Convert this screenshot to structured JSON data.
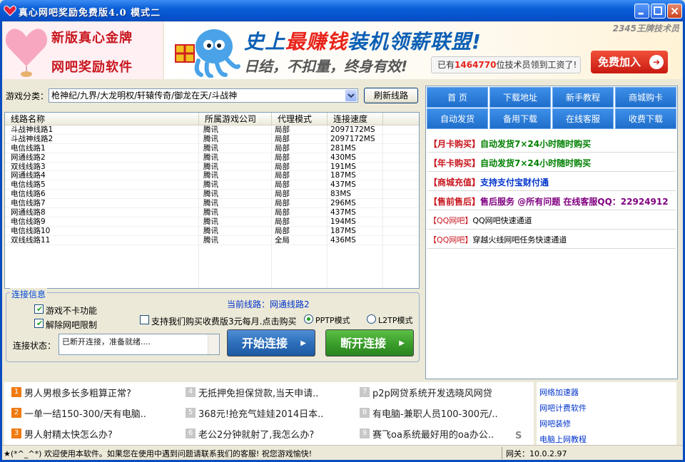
{
  "window": {
    "title": "真心网吧奖励免费版4.0    模式二"
  },
  "banner": {
    "logo_line1": "新版真心金牌",
    "logo_line2": "网吧奖励软件",
    "ad_headline_prefix": "史上",
    "ad_headline_highlight": "最赚钱",
    "ad_headline_suffix": "装机领薪联盟!",
    "ad_sub": "日结，不扣量，终身有效!",
    "ad_count_prefix": "已有",
    "ad_count_number": "1464770",
    "ad_count_suffix": "位技术员领到工资了!",
    "ad_join": "免费加入",
    "ad_corner": "2345王牌技术员"
  },
  "game": {
    "label": "游戏分类：",
    "selected": "枪神纪/九界/大龙明权/轩辕传奇/御龙在天/斗战神",
    "refresh_button": "刷新线路"
  },
  "table": {
    "columns": [
      "线路名称",
      "所属游戏公司",
      "代理模式",
      "连接速度"
    ],
    "rows": [
      [
        "斗战神线路1",
        "腾讯",
        "局部",
        "2097172MS"
      ],
      [
        "斗战神线路2",
        "腾讯",
        "局部",
        "2097172MS"
      ],
      [
        "电信线路1",
        "腾讯",
        "局部",
        "281MS"
      ],
      [
        "网通线路2",
        "腾讯",
        "局部",
        "430MS"
      ],
      [
        "双线线路3",
        "腾讯",
        "局部",
        "191MS"
      ],
      [
        "网通线路4",
        "腾讯",
        "局部",
        "187MS"
      ],
      [
        "电信线路5",
        "腾讯",
        "局部",
        "437MS"
      ],
      [
        "电信线路6",
        "腾讯",
        "局部",
        "83MS"
      ],
      [
        "电信线路7",
        "腾讯",
        "局部",
        "296MS"
      ],
      [
        "网通线路8",
        "腾讯",
        "局部",
        "437MS"
      ],
      [
        "电信线路9",
        "腾讯",
        "局部",
        "194MS"
      ],
      [
        "电信线路10",
        "腾讯",
        "局部",
        "187MS"
      ],
      [
        "双线线路11",
        "腾讯",
        "全局",
        "436MS"
      ]
    ]
  },
  "connection": {
    "group_title": "连接信息",
    "current_line": "当前线路：网通线路2",
    "opt_no_lag": "游戏不卡功能",
    "opt_unlock": "解除网吧限制",
    "opt_buy": "支持我们购买收费版3元每月.点击购买",
    "mode_pptp": "PPTP模式",
    "mode_l2tp": "L2TP模式",
    "status_label": "连接状态：",
    "status_text": "已断开连接，准备就绪....",
    "connect_button": "开始连接",
    "disconnect_button": "断开连接"
  },
  "right_nav": {
    "items": [
      "首 页",
      "下载地址",
      "新手教程",
      "商城购卡",
      "自动发货",
      "备用下载",
      "在线客服",
      "收费下载"
    ]
  },
  "promos": [
    {
      "tag": "【月卡购买】",
      "text": "自动发货7×24小时随时购买"
    },
    {
      "tag": "【年卡购买】",
      "text": "自动发货7×24小时随时购买"
    },
    {
      "tag": "【商城充值】",
      "text": "支持支付宝财付通"
    },
    {
      "tag": "【售前售后】",
      "text": "售后服务 @所有问题 在线客服QQ：22924912"
    },
    {
      "tag": "【QQ网吧】",
      "text": "QQ网吧快速通道"
    },
    {
      "tag": "【QQ网吧】",
      "text": "穿越火线网吧任务快速通道"
    }
  ],
  "news": [
    {
      "num": "1",
      "text": "男人男根多长多粗算正常?"
    },
    {
      "num": "2",
      "text": "一单一结150-300/天有电脑.."
    },
    {
      "num": "3",
      "text": "男人射精太快怎么办?"
    },
    {
      "num": "4",
      "text": "无抵押免担保贷款,当天申请.."
    },
    {
      "num": "5",
      "text": "368元!抢充气娃娃2014日本.."
    },
    {
      "num": "6",
      "text": "老公2分钟就射了,我怎么办?"
    },
    {
      "num": "7",
      "text": "p2p网贷系统开发选晓风网贷"
    },
    {
      "num": "8",
      "text": "有电脑-兼职人员100-300元/.."
    },
    {
      "num": "9",
      "text": "赛飞oa系统最好用的oa办公.."
    }
  ],
  "news_badge": "S",
  "links": [
    "网络加速器",
    "网吧计费软件",
    "网吧装修",
    "电脑上网教程"
  ],
  "statusbar": {
    "message": "★(*^_^*) 欢迎使用本软件。如果您在使用中遇到问题请联系我们的客服! 祝您游戏愉快!",
    "gateway": "网关：10.0.2.97"
  },
  "colors": {
    "titlebar": "#0a5fd8",
    "nav_blue": "#1f6ecb",
    "connect_button": "#2b6cb8",
    "disconnect_button": "#3a9d2a",
    "promo_tag": "#c8161e"
  }
}
